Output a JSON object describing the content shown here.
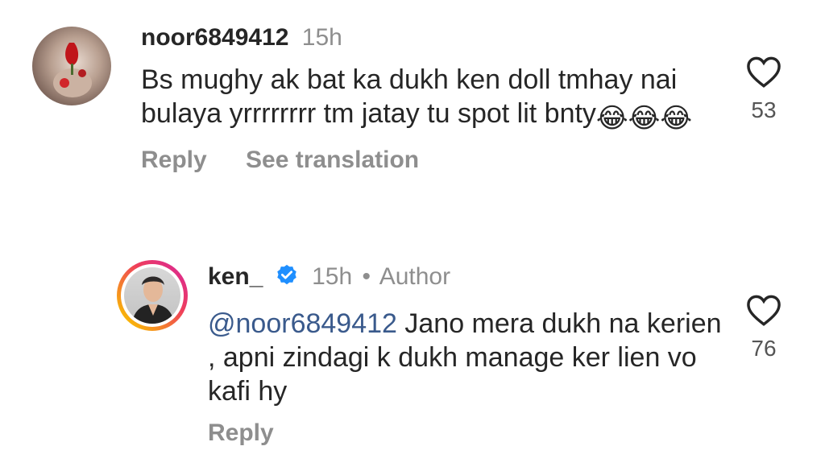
{
  "comment1": {
    "username": "noor6849412",
    "time": "15h",
    "text": "Bs mughy ak bat ka dukh ken doll tmhay nai bulaya yrrrrrrrr tm jatay tu spot lit bnty",
    "emojis": [
      "😂",
      "😂",
      "😂"
    ],
    "reply_label": "Reply",
    "translation_label": "See translation",
    "likes": "53"
  },
  "comment2": {
    "username": "ken_",
    "time": "15h",
    "dot": "•",
    "author_label": "Author",
    "mention": "@noor6849412",
    "text": " Jano mera dukh na kerien , apni zindagi k dukh manage ker lien vo kafi hy",
    "reply_label": "Reply",
    "likes": "76"
  },
  "colors": {
    "verified": "#1f8fff",
    "ring_start": "#f9c000",
    "ring_end": "#d6249f"
  }
}
